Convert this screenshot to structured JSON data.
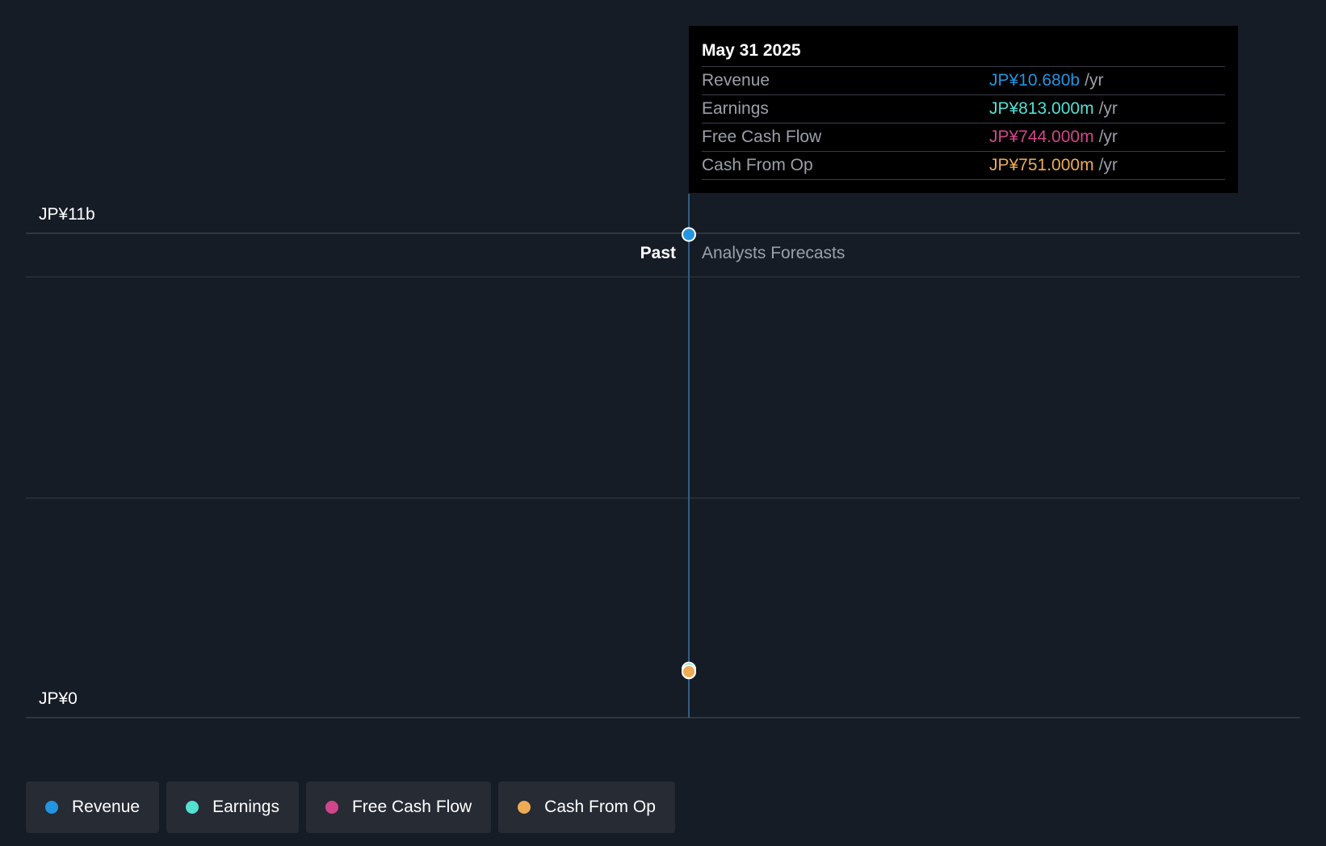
{
  "colors": {
    "background": "#161c26",
    "revenue": "#2394df",
    "earnings": "#54e0d3",
    "free_cash_flow": "#d1468a",
    "cash_from_op": "#eeab56",
    "divider": "#3a3f47"
  },
  "chart_data": {
    "type": "line",
    "x": [
      "May 31 2025"
    ],
    "series": [
      {
        "name": "Revenue",
        "color": "#2394df",
        "values": [
          10.68
        ]
      },
      {
        "name": "Earnings",
        "color": "#54e0d3",
        "values": [
          0.813
        ]
      },
      {
        "name": "Free Cash Flow",
        "color": "#d1468a",
        "values": [
          0.744
        ]
      },
      {
        "name": "Cash From Op",
        "color": "#eeab56",
        "values": [
          0.751
        ]
      }
    ],
    "units": "JP¥ billions",
    "ylim": [
      0,
      11
    ],
    "yticks": [
      {
        "value": 11,
        "label": "JP¥11b"
      },
      {
        "value": 0,
        "label": "JP¥0"
      }
    ],
    "past_label": "Past",
    "forecast_label": "Analysts Forecasts",
    "grid": true,
    "legend_position": "bottom-left"
  },
  "tooltip": {
    "date": "May 31 2025",
    "rows": [
      {
        "name": "Revenue",
        "value": "JP¥10.680b",
        "unit": "/yr",
        "color": "#2394df"
      },
      {
        "name": "Earnings",
        "value": "JP¥813.000m",
        "unit": "/yr",
        "color": "#54e0d3"
      },
      {
        "name": "Free Cash Flow",
        "value": "JP¥744.000m",
        "unit": "/yr",
        "color": "#d1468a"
      },
      {
        "name": "Cash From Op",
        "value": "JP¥751.000m",
        "unit": "/yr",
        "color": "#eeab56"
      }
    ]
  },
  "legend": [
    {
      "label": "Revenue",
      "color": "#2394df"
    },
    {
      "label": "Earnings",
      "color": "#54e0d3"
    },
    {
      "label": "Free Cash Flow",
      "color": "#d1468a"
    },
    {
      "label": "Cash From Op",
      "color": "#eeab56"
    }
  ]
}
